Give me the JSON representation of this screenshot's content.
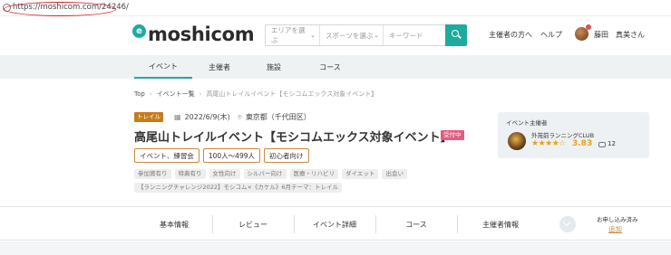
{
  "browser": {
    "url": "https://moshicom.com/24246/"
  },
  "header": {
    "logo_mark": "e",
    "logo_text": "moshicom",
    "search": {
      "area_placeholder": "エリアを選ぶ",
      "sport_placeholder": "スポーツを選ぶ",
      "keyword_placeholder": "キーワード"
    },
    "organizer_link": "主催者の方へ",
    "help_link": "ヘルプ",
    "user_name": "藤田　真美さん"
  },
  "nav": {
    "tabs": [
      "イベント",
      "主催者",
      "施設",
      "コース"
    ],
    "active": "イベント"
  },
  "breadcrumb": [
    "Top",
    "イベント一覧",
    "高尾山トレイルイベント【モシコムエックス対象イベント】"
  ],
  "event": {
    "category": "トレイル",
    "date": "2022/6/9(木)",
    "location": "東京都（千代田区）",
    "title": "高尾山トレイルイベント【モシコムエックス対象イベント】",
    "status": "受付中",
    "attributes": [
      "イベント、練習会",
      "100人〜499人",
      "初心者向け"
    ],
    "tags": [
      "参加賞有り",
      "特典有り",
      "女性向け",
      "シルバー向け",
      "医療・リハビリ",
      "ダイエット",
      "出会い",
      "【ランニングチャレンジ2022】モシコム×《カケル》6月テーマ：トレイル"
    ]
  },
  "organizer": {
    "label": "イベント主催者",
    "name": "外苑前ランニングCLUB",
    "stars": "★★★★☆",
    "rating": "3.83",
    "comments": "12"
  },
  "section_tabs": [
    "基本情報",
    "レビュー",
    "イベント詳細",
    "コース",
    "主催者情報"
  ],
  "apply": {
    "label": "お申し込み済み",
    "link": "追加"
  },
  "colors": {
    "accent": "#1dab9e",
    "category": "#c77b1d",
    "status": "#e15d7d",
    "star": "#e3a21a"
  }
}
